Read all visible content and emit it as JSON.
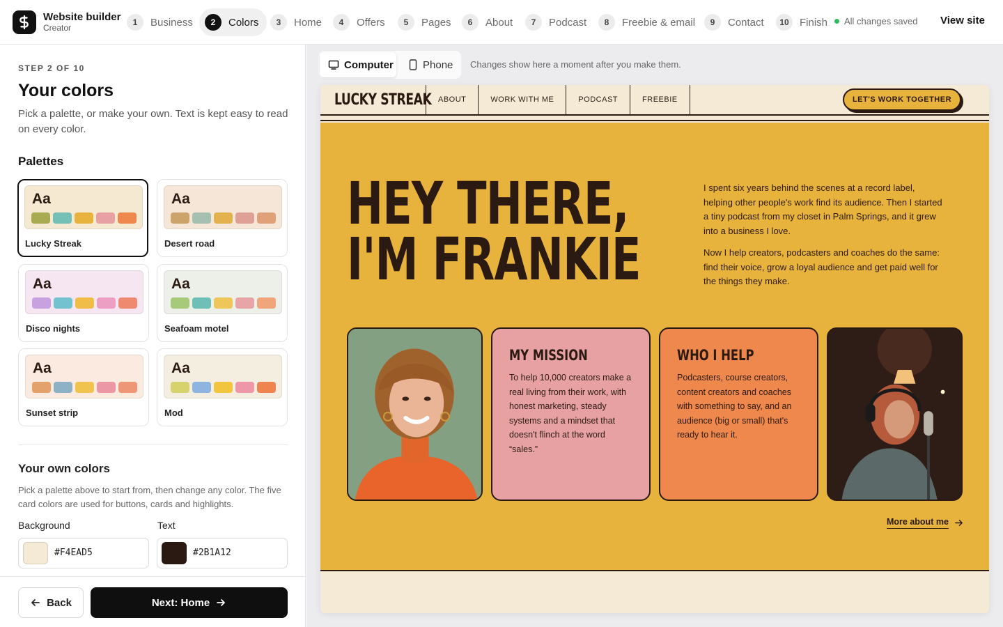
{
  "app": {
    "name": "Website builder",
    "role": "Creator"
  },
  "steps": [
    {
      "num": "1",
      "label": "Business"
    },
    {
      "num": "2",
      "label": "Colors"
    },
    {
      "num": "3",
      "label": "Home"
    },
    {
      "num": "4",
      "label": "Offers"
    },
    {
      "num": "5",
      "label": "Pages"
    },
    {
      "num": "6",
      "label": "About"
    },
    {
      "num": "7",
      "label": "Podcast"
    },
    {
      "num": "8",
      "label": "Freebie & email"
    },
    {
      "num": "9",
      "label": "Contact"
    },
    {
      "num": "10",
      "label": "Finish"
    }
  ],
  "active_step": "2",
  "status": {
    "saved": "All changes saved",
    "view_site": "View site",
    "saved_color": "#2ebd59"
  },
  "panel": {
    "step_label": "STEP 2 OF 10",
    "title": "Your colors",
    "description": "Pick a palette, or make your own. Text is kept easy to read on every color.",
    "palettes_heading": "Palettes",
    "sample_text": "Aa",
    "selected_palette": "Lucky Streak",
    "palettes": [
      {
        "name": "Lucky Streak",
        "bg": "#f5e9d2",
        "chips": [
          "#a8ab52",
          "#74bfb6",
          "#e8b33c",
          "#e8a1a3",
          "#ef884c"
        ]
      },
      {
        "name": "Desert road",
        "bg": "#f5e6d8",
        "chips": [
          "#cda36c",
          "#a5bfb0",
          "#e3b24f",
          "#dfa095",
          "#e0a17a"
        ]
      },
      {
        "name": "Disco nights",
        "bg": "#f6e6f2",
        "chips": [
          "#c8a2e0",
          "#72c3cf",
          "#efbd48",
          "#ec9ec3",
          "#ee8a6f"
        ]
      },
      {
        "name": "Seafoam motel",
        "bg": "#ecf0e8",
        "chips": [
          "#a6c97a",
          "#6ec0b6",
          "#efc65a",
          "#e8a5a7",
          "#f1a57a"
        ]
      },
      {
        "name": "Sunset strip",
        "bg": "#faeadf",
        "chips": [
          "#e3a26b",
          "#8fb1c6",
          "#f0c24e",
          "#ec97a6",
          "#ee9777"
        ]
      },
      {
        "name": "Mod",
        "bg": "#f4eee0",
        "chips": [
          "#d7d26e",
          "#8db5e0",
          "#f1c63e",
          "#ee97a8",
          "#ee8551"
        ]
      }
    ],
    "own": {
      "title": "Your own colors",
      "description": "Pick a palette above to start from, then change any color. The five card colors are used for buttons, cards and highlights.",
      "background_label": "Background",
      "background_value": "#F4EAD5",
      "text_label": "Text",
      "text_value": "#2B1A12"
    },
    "back_label": "Back",
    "next_label": "Next: Home"
  },
  "preview": {
    "device_computer": "Computer",
    "device_phone": "Phone",
    "note": "Changes show here a moment after you make them.",
    "site": {
      "logo": "LUCKY STREAK",
      "menu": [
        "ABOUT",
        "WORK WITH ME",
        "PODCAST",
        "FREEBIE"
      ],
      "cta": "LET'S WORK TOGETHER",
      "hero_line1": "HEY THERE,",
      "hero_line2": "I'M FRANKIE",
      "para1": "I spent six years behind the scenes at a record label, helping other people's work find its audience. Then I started a tiny podcast from my closet in Palm Springs, and it grew into a business I love.",
      "para2": "Now I help creators, podcasters and coaches do the same: find their voice, grow a loyal audience and get paid well for the things they make.",
      "mission_title": "MY MISSION",
      "mission_text": "To help 10,000 creators make a real living from their work, with honest marketing, steady systems and a mindset that doesn't flinch at the word “sales.”",
      "who_title": "WHO I HELP",
      "who_text": "Podcasters, course creators, content creators and coaches with something to say, and an audience (big or small) that's ready to hear it.",
      "more_link": "More about me"
    }
  }
}
